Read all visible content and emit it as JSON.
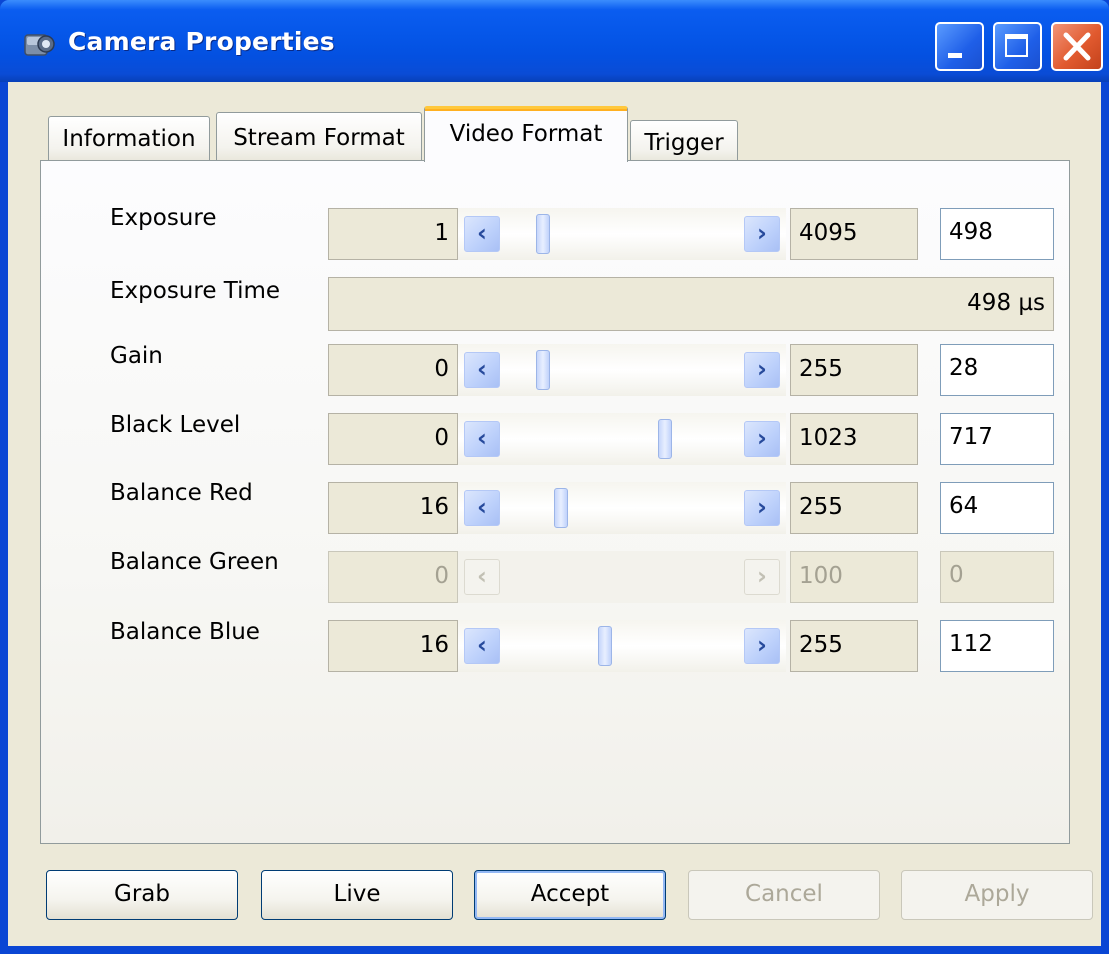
{
  "window": {
    "title": "Camera Properties"
  },
  "tabs": [
    {
      "label": "Information",
      "active": false
    },
    {
      "label": "Stream Format",
      "active": false
    },
    {
      "label": "Video Format",
      "active": true
    },
    {
      "label": "Trigger",
      "active": false
    }
  ],
  "rows": {
    "exposure": {
      "label": "Exposure",
      "min": "1",
      "max": "4095",
      "value": "498",
      "enabled": true
    },
    "exposure_time": {
      "label": "Exposure Time",
      "value": "498 µs"
    },
    "gain": {
      "label": "Gain",
      "min": "0",
      "max": "255",
      "value": "28",
      "enabled": true
    },
    "black_level": {
      "label": "Black Level",
      "min": "0",
      "max": "1023",
      "value": "717",
      "enabled": true
    },
    "balance_red": {
      "label": "Balance Red",
      "min": "16",
      "max": "255",
      "value": "64",
      "enabled": true
    },
    "balance_green": {
      "label": "Balance Green",
      "min": "0",
      "max": "100",
      "value": "0",
      "enabled": false
    },
    "balance_blue": {
      "label": "Balance Blue",
      "min": "16",
      "max": "255",
      "value": "112",
      "enabled": true
    }
  },
  "buttons": {
    "grab": "Grab",
    "live": "Live",
    "accept": "Accept",
    "cancel": "Cancel",
    "apply": "Apply"
  },
  "colors": {
    "titlebar": "#0556e8",
    "dialog_bg": "#ece9d8",
    "active_tab_accent": "#ffc83c",
    "slider_accent": "#bcd0fb"
  }
}
